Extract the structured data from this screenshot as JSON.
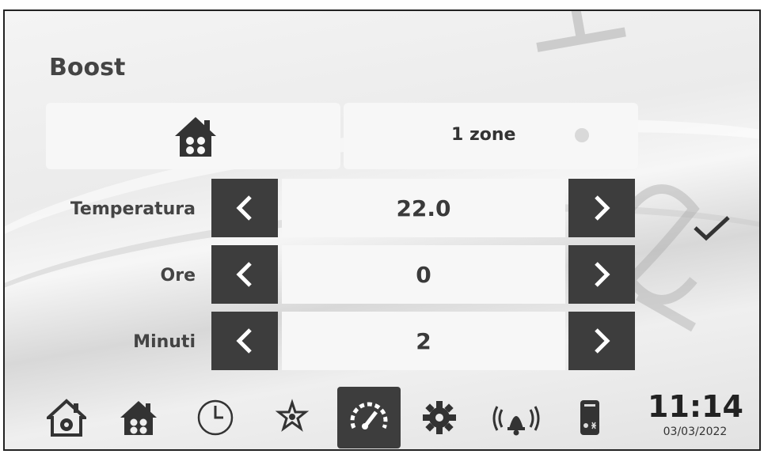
{
  "screen": {
    "title": "Boost",
    "zone_label": "1 zone",
    "rows": [
      {
        "label": "Temperatura",
        "value": "22.0"
      },
      {
        "label": "Ore",
        "value": "0"
      },
      {
        "label": "Minuti",
        "value": "2"
      }
    ],
    "confirm_icon": "checkmark-icon"
  },
  "nav": {
    "items": [
      {
        "icon": "home-zone-icon",
        "active": false
      },
      {
        "icon": "house-icon",
        "active": false
      },
      {
        "icon": "clock-icon",
        "active": false
      },
      {
        "icon": "stars-icon",
        "active": false
      },
      {
        "icon": "boost-gauge-icon",
        "active": true
      },
      {
        "icon": "gear-icon",
        "active": false
      },
      {
        "icon": "alarm-bell-icon",
        "active": false
      },
      {
        "icon": "boiler-icon",
        "active": false
      }
    ]
  },
  "status": {
    "time": "11:14",
    "date": "03/03/2022"
  },
  "colors": {
    "dark_button": "#3d3d3d",
    "panel": "#f7f7f7",
    "text": "#444444"
  }
}
